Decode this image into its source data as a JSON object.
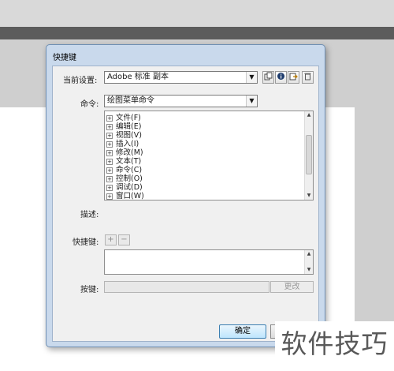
{
  "dialog": {
    "title": "快捷键",
    "preset_label": "当前设置:",
    "preset_value": "Adobe 标准 副本",
    "command_label": "命令:",
    "command_value": "绘图菜单命令",
    "description_label": "描述:",
    "shortcut_label": "快捷键:",
    "add_label": "+",
    "remove_label": "−",
    "key_label": "按键:",
    "change_label": "更改",
    "ok_label": "确定"
  },
  "tree_items": [
    "文件(F)",
    "编辑(E)",
    "视图(V)",
    "插入(I)",
    "修改(M)",
    "文本(T)",
    "命令(C)",
    "控制(O)",
    "调试(D)",
    "窗口(W)"
  ],
  "watermark": "软件技巧",
  "icons": {
    "expander": "⊞",
    "dropdown": "▼",
    "scroll_up": "▲",
    "scroll_down": "▼",
    "scroll_grip": "≡"
  }
}
